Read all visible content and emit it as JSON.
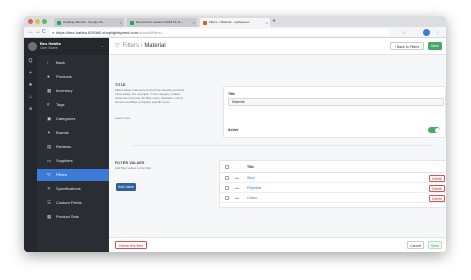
{
  "browser": {
    "tabs": [
      {
        "label": "Heading data file · Google Sh...",
        "favicon_color": "#1fa463"
      },
      {
        "label": "Ecommerce research 2018 FS 11...",
        "favicon_color": "#1fa463"
      },
      {
        "label": "Filters > Material · Lightspeed...",
        "favicon_color": "#e4572e"
      }
    ],
    "new_tab": "+",
    "url_host": "https://bes-habita-8393d0.shoplightspeed.com",
    "url_path": "/admin/filters/...",
    "nav": {
      "back": "←",
      "forward": "→",
      "reload": "C"
    },
    "icons": {
      "star": "☆",
      "profile": "●",
      "menu": "⋮"
    },
    "accent_color": "#3d7bd9"
  },
  "sidebar": {
    "store_name": "Bes Habita",
    "user_name": "User Name",
    "items": [
      {
        "label": "Back",
        "icon": "‹"
      },
      {
        "label": "Products",
        "icon": "●"
      },
      {
        "label": "Inventory",
        "icon": "▦"
      },
      {
        "label": "Tags",
        "icon": "#"
      },
      {
        "label": "Categories",
        "icon": "▣"
      },
      {
        "label": "Brands",
        "icon": "✦"
      },
      {
        "label": "Reviews",
        "icon": "▤"
      },
      {
        "label": "Suppliers",
        "icon": "▭"
      },
      {
        "label": "Filters",
        "icon": "▽"
      },
      {
        "label": "Specifications",
        "icon": "✕"
      },
      {
        "label": "Custom Fields",
        "icon": "☰"
      },
      {
        "label": "Product Sets",
        "icon": "▦"
      }
    ],
    "rail_icons": [
      "Q",
      "+",
      "★",
      "⌂",
      "■"
    ]
  },
  "header": {
    "section": "Filters",
    "separator": "›",
    "title": "Material",
    "back_button": "‹ Back to Filters",
    "save_button": "Save"
  },
  "title_section": {
    "heading": "TITLE",
    "description": "Filters allow customers to find their favorite products more easily. For example, in the category, Ladies, customers can use the filter Color, Sweaters, using women and Blue to display specific items.",
    "link": "Learn more",
    "title_label": "Title",
    "title_value": "Material",
    "active_label": "Active",
    "active": true
  },
  "values_section": {
    "heading": "FILTER VALUES",
    "description": "Add filter values to the filter",
    "add_button": "Add Value",
    "column_title": "Title",
    "rows": [
      {
        "title": "Wool",
        "delete": "Delete"
      },
      {
        "title": "Polyester",
        "delete": "Delete"
      },
      {
        "title": "Cotton",
        "delete": "Delete"
      }
    ]
  },
  "footer": {
    "delete_filter": "Delete this filter",
    "cancel": "Cancel",
    "save": "Save"
  }
}
